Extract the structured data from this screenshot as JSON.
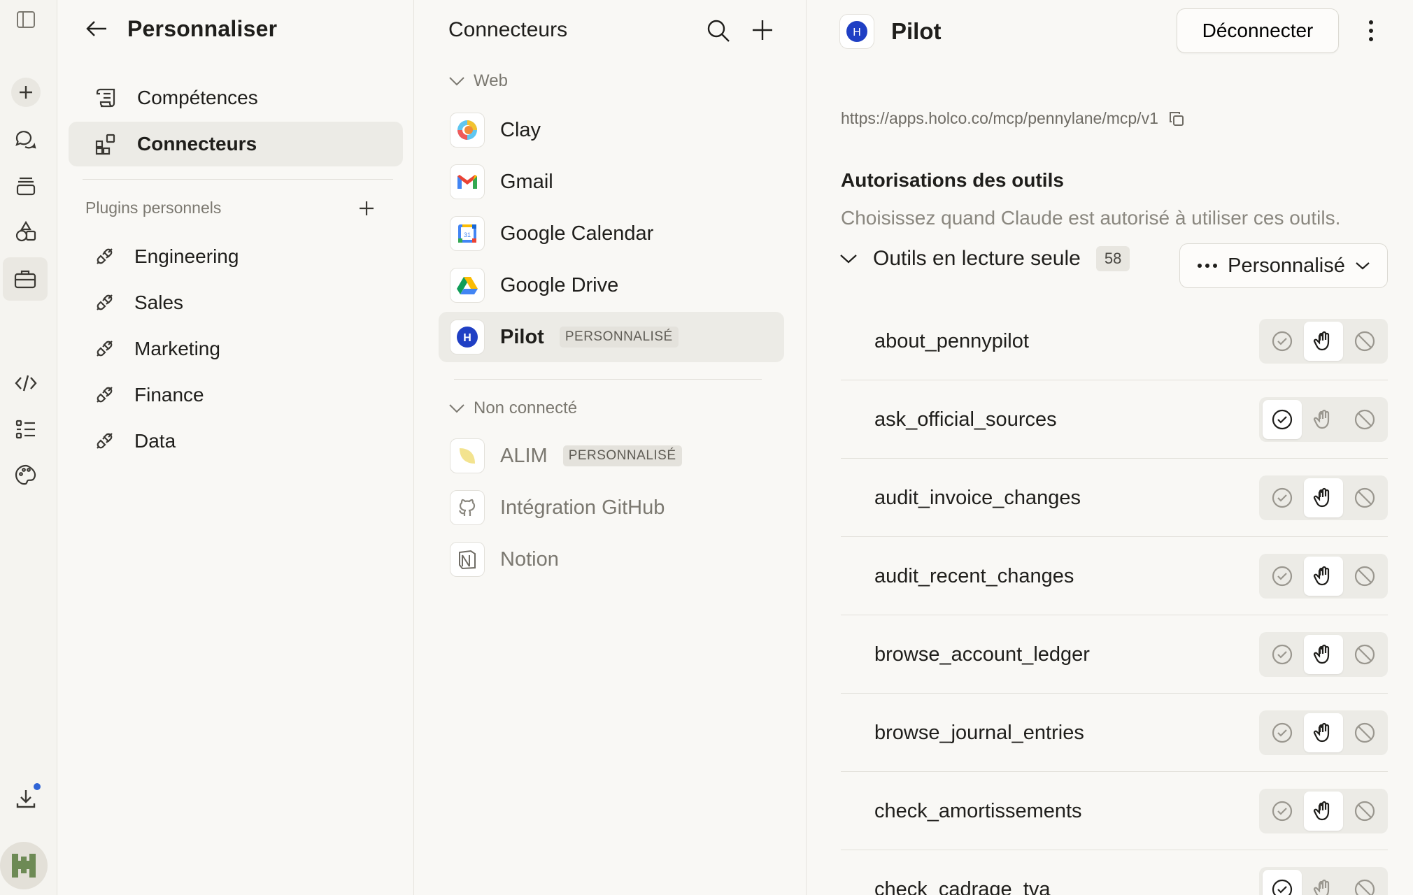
{
  "col1": {
    "title": "Personnaliser",
    "nav": [
      {
        "label": "Compétences",
        "icon": "scroll-icon"
      },
      {
        "label": "Connecteurs",
        "icon": "grid-plus-icon"
      }
    ],
    "plugins_label": "Plugins personnels",
    "plugins": [
      "Engineering",
      "Sales",
      "Marketing",
      "Finance",
      "Data"
    ]
  },
  "col2": {
    "title": "Connecteurs",
    "groups": [
      {
        "label": "Web"
      },
      {
        "label": "Non connecté"
      }
    ],
    "connected": [
      {
        "name": "Clay",
        "badge": ""
      },
      {
        "name": "Gmail",
        "badge": ""
      },
      {
        "name": "Google Calendar",
        "badge": ""
      },
      {
        "name": "Google Drive",
        "badge": ""
      },
      {
        "name": "Pilot",
        "badge": "PERSONNALISÉ"
      }
    ],
    "disconnected": [
      {
        "name": "ALIM",
        "badge": "PERSONNALISÉ"
      },
      {
        "name": "Intégration GitHub",
        "badge": ""
      },
      {
        "name": "Notion",
        "badge": ""
      }
    ]
  },
  "col3": {
    "title": "Pilot",
    "disconnect_label": "Déconnecter",
    "url": "https://apps.holco.co/mcp/pennylane/mcp/v1",
    "permissions_title": "Autorisations des outils",
    "permissions_desc": "Choisissez quand Claude est autorisé à utiliser ces outils.",
    "group_label": "Outils en lecture seule",
    "group_count": "58",
    "mode_label": "Personnalisé",
    "tools": [
      {
        "name": "about_pennypilot",
        "mode": "ask"
      },
      {
        "name": "ask_official_sources",
        "mode": "allow"
      },
      {
        "name": "audit_invoice_changes",
        "mode": "ask"
      },
      {
        "name": "audit_recent_changes",
        "mode": "ask"
      },
      {
        "name": "browse_account_ledger",
        "mode": "ask"
      },
      {
        "name": "browse_journal_entries",
        "mode": "ask"
      },
      {
        "name": "check_amortissements",
        "mode": "ask"
      },
      {
        "name": "check_cadrage_tva",
        "mode": "allow"
      }
    ]
  },
  "colors": {
    "accent_blue": "#2f64d6",
    "pilot_blue": "#1f3fc4",
    "background": "#f9f8f5"
  }
}
